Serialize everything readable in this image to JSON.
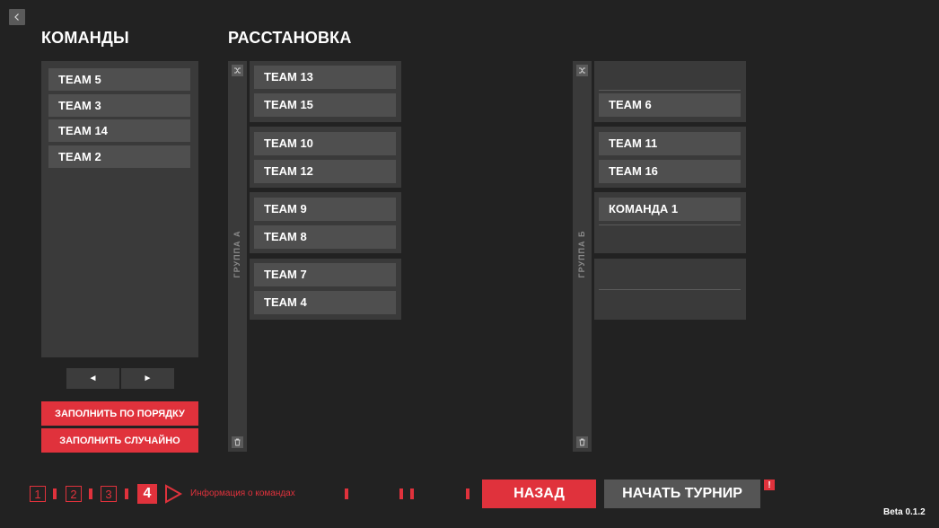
{
  "colors": {
    "background": "#222222",
    "panel": "#3a3a3a",
    "item": "#4f4f4f",
    "accent": "#e0323c",
    "muted_button": "#555555"
  },
  "back_button": {
    "icon": "chevron-left-icon"
  },
  "teams_panel": {
    "title": "КОМАНДЫ",
    "teams": [
      "TEAM 5",
      "TEAM 3",
      "TEAM 14",
      "TEAM 2"
    ],
    "prev_label": "◄",
    "next_label": "►",
    "fill_order_label": "ЗАПОЛНИТЬ ПО ПОРЯДКУ",
    "fill_random_label": "ЗАПОЛНИТЬ СЛУЧАЙНО"
  },
  "placement": {
    "title": "РАССТАНОВКА",
    "group_a": {
      "label": "ГРУППА А",
      "pairs": [
        [
          "TEAM 13",
          "TEAM 15"
        ],
        [
          "TEAM 10",
          "TEAM 12"
        ],
        [
          "TEAM 9",
          "TEAM 8"
        ],
        [
          "TEAM 7",
          "TEAM 4"
        ]
      ]
    },
    "group_b": {
      "label": "ГРУППА Б",
      "pairs": [
        [
          "",
          "TEAM 6"
        ],
        [
          "TEAM 11",
          "TEAM 16"
        ],
        [
          "КОМАНДА 1",
          ""
        ],
        [
          "",
          ""
        ]
      ]
    }
  },
  "footer": {
    "steps": [
      "1",
      "2",
      "3",
      "4"
    ],
    "active_step": "4",
    "step_caption": "Информация о командах",
    "back_label": "НАЗАД",
    "start_label": "НАЧАТЬ ТУРНИР",
    "warning_badge": "!",
    "version": "Beta 0.1.2"
  }
}
